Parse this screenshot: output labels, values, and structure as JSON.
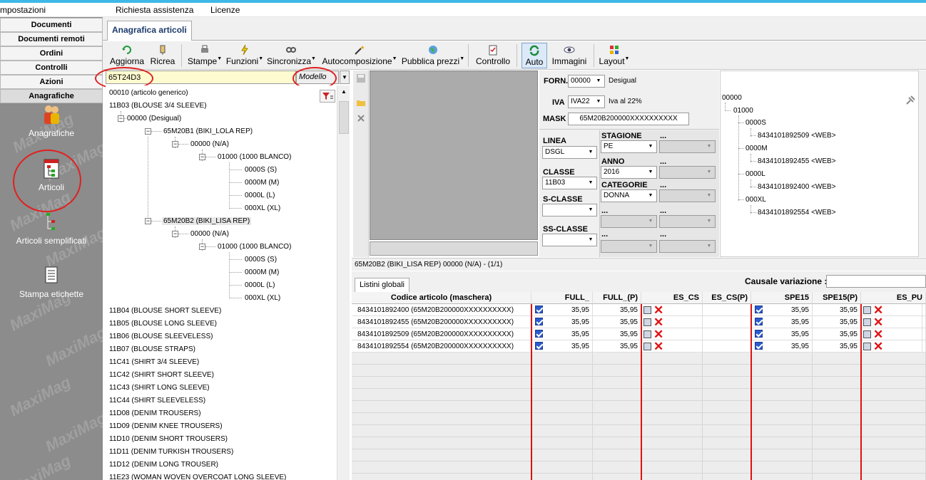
{
  "menubar": [
    "mpostazioni",
    "Richiesta assistenza",
    "Licenze"
  ],
  "nav": {
    "buttons": [
      "Documenti",
      "Documenti remoti",
      "Ordini",
      "Controlli",
      "Azioni",
      "Anagrafiche"
    ],
    "watermark": "MaxiMag",
    "icons": [
      {
        "label": "Anagrafiche",
        "icon": "people-icon"
      },
      {
        "label": "Articoli",
        "icon": "article-tree-icon"
      },
      {
        "label": "Articoli semplificati",
        "icon": "simple-article-icon"
      },
      {
        "label": "Stampa etichette",
        "icon": "label-print-icon"
      }
    ]
  },
  "tab": {
    "title": "Anagrafica articoli"
  },
  "toolbar": [
    {
      "label": "Aggiorna",
      "icon": "refresh-icon"
    },
    {
      "label": "Ricrea",
      "icon": "recreate-icon"
    },
    {
      "label": "Stampe",
      "icon": "print-icon",
      "dropdown": true
    },
    {
      "label": "Funzioni",
      "icon": "lightning-icon",
      "dropdown": true
    },
    {
      "label": "Sincronizza",
      "icon": "sync-icon",
      "dropdown": true
    },
    {
      "label": "Autocomposizione",
      "icon": "wand-icon",
      "dropdown": true
    },
    {
      "label": "Pubblica prezzi",
      "icon": "globe-icon",
      "dropdown": true
    },
    {
      "label": "Controllo",
      "icon": "checklist-icon"
    },
    {
      "label": "Auto",
      "icon": "auto-sync-icon",
      "active": true
    },
    {
      "label": "Immagini",
      "icon": "eye-icon"
    },
    {
      "label": "Layout",
      "icon": "layout-icon",
      "dropdown": true
    }
  ],
  "search": {
    "value": "65T24D3",
    "mode": "Modello"
  },
  "tree": {
    "top": [
      "00010 (articolo generico)",
      "11B03 (BLOUSE 3/4 SLEEVE)"
    ],
    "supplier": "00000 (Desigual)",
    "model1": "65M20B1 (BIKI_LOLA REP)",
    "model1_var": "00000 (N/A)",
    "model1_color": "01000 (1000 BLANCO)",
    "model1_sizes": [
      "0000S (S)",
      "0000M (M)",
      "0000L (L)",
      "000XL (XL)"
    ],
    "model2": "65M20B2 (BIKI_LISA REP)",
    "model2_var": "00000 (N/A)",
    "model2_color": "01000 (1000 BLANCO)",
    "model2_sizes": [
      "0000S (S)",
      "0000M (M)",
      "0000L (L)",
      "000XL (XL)"
    ],
    "rest": [
      "11B04 (BLOUSE SHORT SLEEVE)",
      "11B05 (BLOUSE LONG SLEEVE)",
      "11B06 (BLOUSE SLEEVELESS)",
      "11B07 (BLOUSE STRAPS)",
      "11C41 (SHIRT 3/4 SLEEVE)",
      "11C42 (SHIRT SHORT SLEEVE)",
      "11C43 (SHIRT LONG SLEEVE)",
      "11C44 (SHIRT SLEEVELESS)",
      "11D08 (DENIM TROUSERS)",
      "11D09 (DENIM KNEE TROUSERS)",
      "11D10 (DENIM SHORT TROUSERS)",
      "11D11 (DENIM TURKISH TROUSERS)",
      "11D12 (DENIM LONG TROUSER)",
      "11E23 (WOMAN WOVEN OVERCOAT LONG SLEEVE)"
    ]
  },
  "props": {
    "forn_label": "FORN.",
    "forn_value": "00000",
    "forn_name": "Desigual",
    "iva_label": "IVA",
    "iva_value": "IVA22",
    "iva_desc": "Iva al 22%",
    "mask_label": "MASK",
    "mask_value": "65M20B200000XXXXXXXXXX",
    "linea_label": "LINEA",
    "linea_value": "DSGL",
    "classe_label": "CLASSE",
    "classe_value": "11B03",
    "sclasse_label": "S-CLASSE",
    "ssclasse_label": "SS-CLASSE",
    "stagione_label": "STAGIONE",
    "stagione_value": "PE",
    "anno_label": "ANNO",
    "anno_value": "2016",
    "categorie_label": "CATEGORIE",
    "categorie_value": "DONNA",
    "dots": "..."
  },
  "status": "65M20B2 (BIKI_LISA REP) 00000 (N/A)  - (1/1)",
  "rtree": {
    "root": "00000",
    "color": "01000",
    "sizes": [
      {
        "size": "0000S",
        "code": "8434101892509 <WEB>"
      },
      {
        "size": "0000M",
        "code": "8434101892455 <WEB>"
      },
      {
        "size": "0000L",
        "code": "8434101892400 <WEB>"
      },
      {
        "size": "000XL",
        "code": "8434101892554 <WEB>"
      }
    ]
  },
  "causale": {
    "label": "Causale variazione :",
    "tab": "Listini globali"
  },
  "grid": {
    "headers": [
      "Codice articolo (maschera)",
      "FULL_",
      "FULL_(P)",
      "ES_CS",
      "ES_CS(P)",
      "SPE15",
      "SPE15(P)",
      "ES_PU"
    ],
    "rows": [
      {
        "code": "8434101892400 (65M20B200000XXXXXXXXXX)",
        "full": "35,95",
        "fullp": "35,95",
        "spe": "35,95",
        "spep": "35,95"
      },
      {
        "code": "8434101892455 (65M20B200000XXXXXXXXXX)",
        "full": "35,95",
        "fullp": "35,95",
        "spe": "35,95",
        "spep": "35,95"
      },
      {
        "code": "8434101892509 (65M20B200000XXXXXXXXXX)",
        "full": "35,95",
        "fullp": "35,95",
        "spe": "35,95",
        "spep": "35,95"
      },
      {
        "code": "8434101892554 (65M20B200000XXXXXXXXXX)",
        "full": "35,95",
        "fullp": "35,95",
        "spe": "35,95",
        "spep": "35,95"
      }
    ]
  },
  "colors": {
    "accent": "#3fb8e8",
    "annotation": "#e02020",
    "nav_bg": "#8c8c8c",
    "search_bg": "#fffbd0"
  }
}
